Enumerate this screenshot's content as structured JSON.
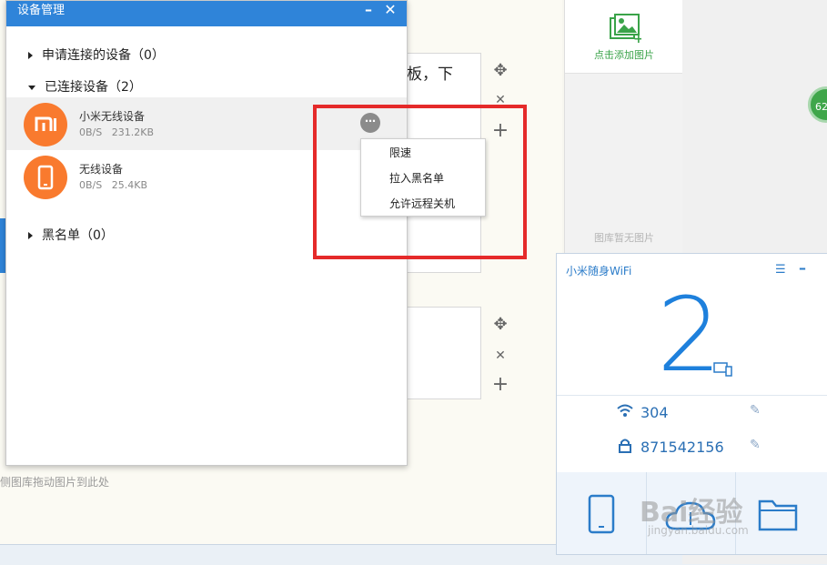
{
  "dialog": {
    "title": "设备管理",
    "sections": {
      "requested": "申请连接的设备（0）",
      "connected": "已连接设备（2）",
      "blacklist": "黑名单（0）"
    },
    "devices": [
      {
        "name": "小米无线设备",
        "speed": "0B/S",
        "traffic": "231.2KB"
      },
      {
        "name": "无线设备",
        "speed": "0B/S",
        "traffic": "25.4KB"
      }
    ]
  },
  "context_menu": {
    "items": [
      "限速",
      "拉入黑名单",
      "允许远程关机"
    ]
  },
  "gallery": {
    "add_label": "点击添加图片",
    "empty_label": "图库暂无图片"
  },
  "background": {
    "partial_text": "平板，下",
    "hint_text": "侧图库拖动图片到此处"
  },
  "wifi_panel": {
    "title": "小米随身WiFi",
    "device_count": "2",
    "ssid": "304",
    "password": "871542156"
  },
  "side_badge": "62",
  "watermark": {
    "logo": "Bai经验",
    "url": "jingyan.baidu.com"
  },
  "colors": {
    "accent": "#2f84d9",
    "highlight": "#e52a2a",
    "device_orange": "#f97a2e"
  }
}
